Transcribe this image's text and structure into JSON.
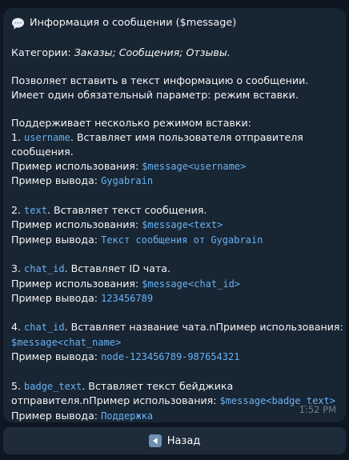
{
  "message": {
    "icon": "speech-balloon-icon",
    "title": "Информация о сообщении ($message)",
    "categories": {
      "label": "Категории: ",
      "value": "Заказы; Сообщения; Отзывы."
    },
    "description": [
      "Позволяет вставить в текст информацию о сообщении.",
      "Имеет один обязательный параметр: режим вставки."
    ],
    "modes_intro": "Поддерживает несколько режимом вставки:",
    "usage_label": "Пример использования: ",
    "output_label": "Пример вывода: ",
    "items": [
      {
        "num": "1. ",
        "code": "username",
        "desc_1": ". Вставляет имя пользователя отправителя",
        "desc_2": "сообщения.",
        "usage": "$message<username>",
        "output": "Gygabrain"
      },
      {
        "num": "2. ",
        "code": "text",
        "desc": ". Вставляет текст сообщения.",
        "usage": "$message<text>",
        "output": "Текст сообщения от Gygabrain"
      },
      {
        "num": "3. ",
        "code": "chat_id",
        "desc": ". Вставляет ID чата.",
        "usage": "$message<chat_id>",
        "output": "123456789"
      },
      {
        "num": "4. ",
        "code": "chat_id",
        "desc": ". Вставляет название чата.nПример использования: ",
        "usage": "$message<chat_name>",
        "output": "node-123456789-987654321"
      },
      {
        "num": "5. ",
        "code": "badge_text",
        "desc_1": ". Вставляет текст бейджика",
        "desc_2": "отправителя.nПример использования: ",
        "usage": "$message<badge_text>",
        "output": "Поддержка"
      }
    ],
    "time": "1:52 PM"
  },
  "keyboard": {
    "back_icon": "back-arrow-icon",
    "back_label": "Назад"
  }
}
